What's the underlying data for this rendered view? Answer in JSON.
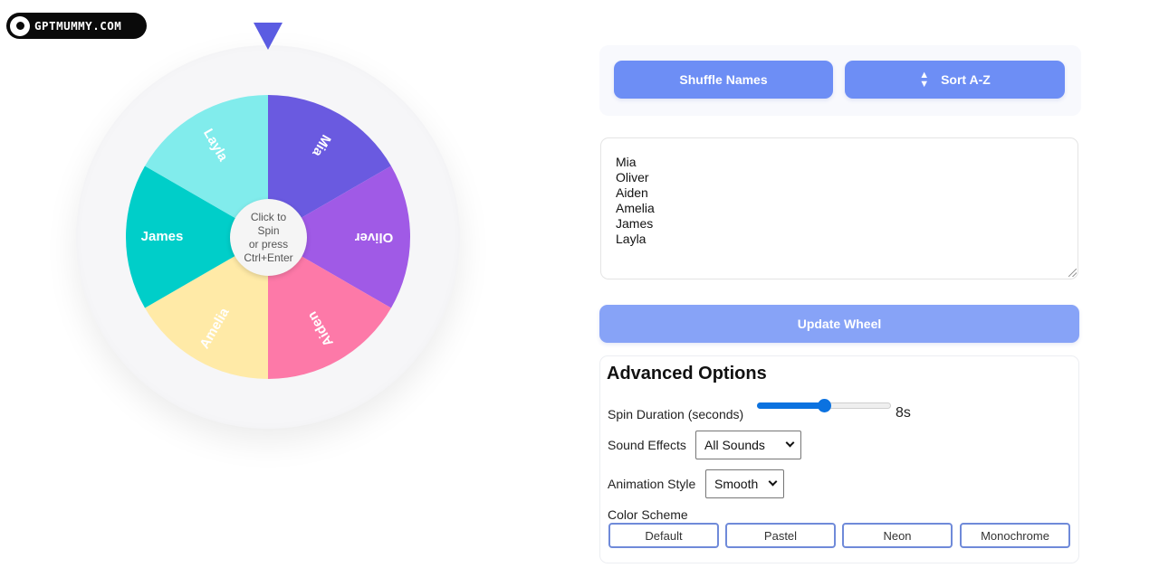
{
  "brand": {
    "logo_text": "GPTMUMMY.COM"
  },
  "wheel": {
    "spin_prompt": [
      "Click to",
      "Spin",
      "or press",
      "Ctrl+Enter"
    ],
    "segments": [
      {
        "label": "Mia",
        "color": "#6a5ae0"
      },
      {
        "label": "Oliver",
        "color": "#a05ae6"
      },
      {
        "label": "Aiden",
        "color": "#fd79a8"
      },
      {
        "label": "Amelia",
        "color": "#ffeaa7"
      },
      {
        "label": "James",
        "color": "#00cec9"
      },
      {
        "label": "Layla",
        "color": "#81ecec"
      }
    ],
    "pointer_color": "#5b5ce2"
  },
  "controls": {
    "shuffle_label": "Shuffle Names",
    "sort_label": "Sort A-Z",
    "sort_icon": "sort-updown-icon"
  },
  "names_input": {
    "lines": [
      "Mia",
      "Oliver",
      "Aiden",
      "Amelia",
      "James",
      "Layla"
    ]
  },
  "update_label": "Update Wheel",
  "advanced": {
    "title": "Advanced Options",
    "spin_duration": {
      "label": "Spin Duration (seconds)",
      "value_text": "8s",
      "fraction": 0.5
    },
    "sound_effects": {
      "label": "Sound Effects",
      "selected": "All Sounds"
    },
    "animation_style": {
      "label": "Animation Style",
      "selected": "Smooth"
    },
    "color_scheme": {
      "label": "Color Scheme",
      "options": [
        "Default",
        "Pastel",
        "Neon",
        "Monochrome"
      ]
    }
  },
  "colors": {
    "accent": "#6d8ef5",
    "accent_light": "#87a3f7",
    "slider": "#0b72e0"
  }
}
